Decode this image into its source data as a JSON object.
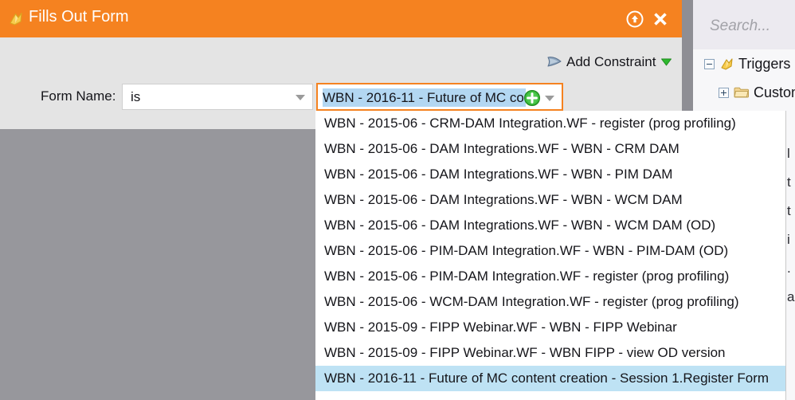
{
  "dialog": {
    "title": "Fills Out Form",
    "title_icon": "trigger-lightning-icon",
    "maximize_icon": "circle-up-arrow-icon",
    "close_icon": "close-x-icon",
    "accent_color": "#f58220",
    "add_constraint": {
      "label": "Add Constraint",
      "icon": "funnel-icon",
      "caret_icon": "green-caret-down-icon"
    },
    "form_row": {
      "label": "Form Name:",
      "operator_value": "is",
      "operator_caret_icon": "chevron-down-icon",
      "value_text": "WBN - 2016-11 - Future of MC co",
      "value_plus_icon": "green-plus-icon",
      "value_caret_icon": "chevron-down-icon",
      "selection_color": "#b3d7f2"
    }
  },
  "dropdown": {
    "highlight_color": "#bee2f4",
    "selected_index": 10,
    "items": [
      "WBN - 2015-06 - CRM-DAM Integration.WF - register (prog profiling)",
      "WBN - 2015-06 - DAM Integrations.WF - WBN - CRM DAM",
      "WBN - 2015-06 - DAM Integrations.WF - WBN - PIM DAM",
      "WBN - 2015-06 - DAM Integrations.WF - WBN - WCM DAM",
      "WBN - 2015-06 - DAM Integrations.WF - WBN - WCM DAM (OD)",
      "WBN - 2015-06 - PIM-DAM Integration.WF - WBN - PIM-DAM (OD)",
      "WBN - 2015-06 - PIM-DAM Integration.WF - register (prog profiling)",
      "WBN - 2015-06 - WCM-DAM Integration.WF - register (prog profiling)",
      "WBN - 2015-09 - FIPP Webinar.WF - WBN - FIPP Webinar",
      "WBN - 2015-09 - FIPP Webinar.WF - WBN FIPP - view OD version",
      "WBN - 2016-11 - Future of MC content creation - Session 1.Register Form"
    ]
  },
  "right_panel": {
    "search": {
      "placeholder": "Search...",
      "value": ""
    },
    "tree": [
      {
        "label": "Triggers",
        "level": 1,
        "expander": "minus",
        "icon": "trigger-lightning-icon"
      },
      {
        "label": "Custom",
        "level": 2,
        "expander": "plus",
        "icon": "folder-icon"
      }
    ],
    "background_text_fragments": [
      "",
      "l",
      "t",
      "t",
      "i",
      ".",
      "a",
      ""
    ]
  }
}
